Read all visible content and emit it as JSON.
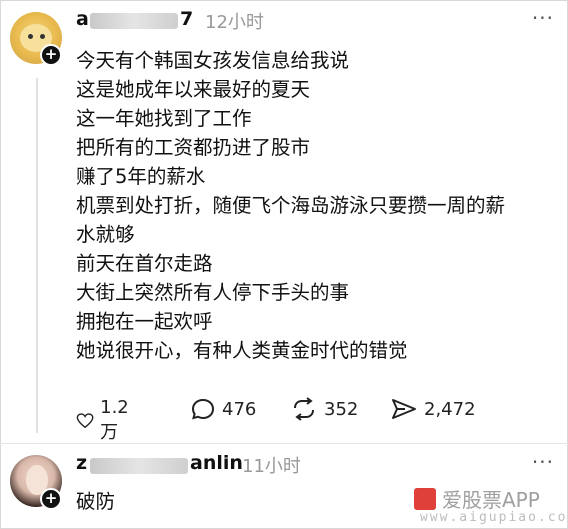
{
  "post": {
    "username_visible_start": "a",
    "username_visible_end": "7",
    "time": "12小时",
    "more": "···",
    "lines": [
      "今天有个韩国女孩发信息给我说",
      "这是她成年以来最好的夏天",
      "这一年她找到了工作",
      "把所有的工资都扔进了股市",
      "赚了5年的薪水",
      "机票到处打折，随便飞个海岛游泳只要攒一周的薪",
      "水就够",
      "前天在首尔走路",
      "大街上突然所有人停下手头的事",
      "拥抱在一起欢呼",
      "她说很开心，有种人类黄金时代的错觉"
    ],
    "likes": "1.2 万",
    "comments": "476",
    "reposts": "352",
    "shares": "2,472",
    "icons": {
      "like": "heart-icon",
      "comment": "speech-bubble-icon",
      "repost": "repost-arrows-icon",
      "share": "send-icon"
    }
  },
  "reply": {
    "username_visible_start": "z",
    "username_visible_end": "anlin",
    "time": "11小时",
    "more": "···",
    "text": "破防"
  },
  "watermark": {
    "label": "爱股票APP",
    "url": "www.aigupiao.com"
  }
}
